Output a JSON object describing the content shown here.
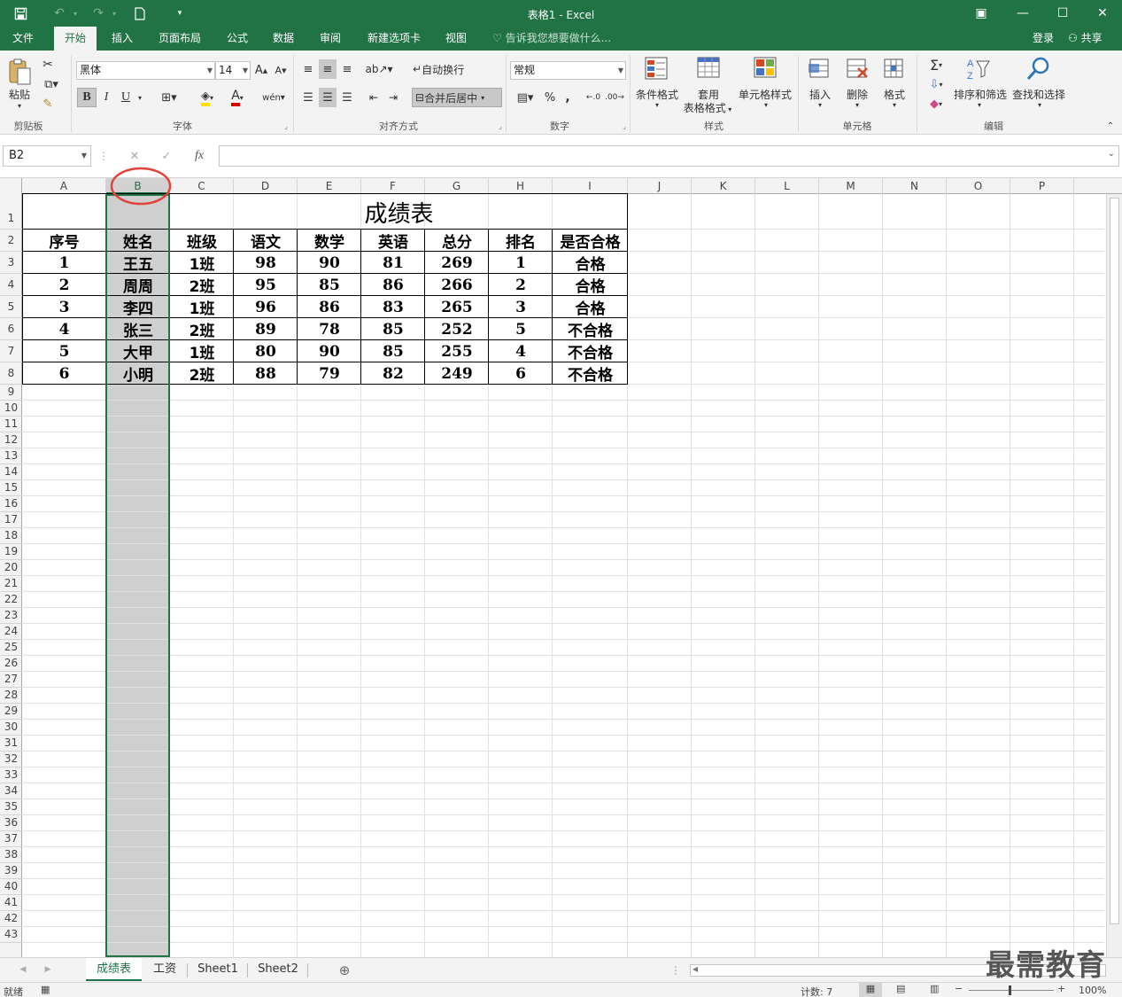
{
  "window": {
    "title": "表格1 - Excel"
  },
  "quick_access": {
    "save_icon": "save-icon",
    "undo_icon": "undo-icon",
    "redo_icon": "redo-icon",
    "new_icon": "new-document-icon",
    "customize_icon": "customize-icon"
  },
  "window_controls": {
    "ribbon_display": "▣",
    "minimize": "—",
    "maximize": "☐",
    "close": "✕"
  },
  "ribbon_tabs": [
    "文件",
    "开始",
    "插入",
    "页面布局",
    "公式",
    "数据",
    "审阅",
    "新建选项卡",
    "视图"
  ],
  "active_tab": "开始",
  "tell_me": "告诉我您想要做什么...",
  "account": {
    "login": "登录",
    "share": "共享"
  },
  "ribbon": {
    "clipboard": {
      "label": "剪贴板",
      "paste": "粘贴"
    },
    "font": {
      "label": "字体",
      "name": "黑体",
      "size": "14",
      "bold": "B",
      "italic": "I",
      "underline": "U",
      "grow": "A",
      "shrink": "A"
    },
    "alignment": {
      "label": "对齐方式",
      "wrap_text": "自动换行",
      "merge_center": "合并后居中"
    },
    "number": {
      "label": "数字",
      "format": "常规",
      "percent": "%",
      "comma": ","
    },
    "styles": {
      "label": "样式",
      "conditional": "条件格式",
      "table_1": "套用",
      "table_2": "表格格式",
      "cell_styles": "单元格样式"
    },
    "cells": {
      "label": "单元格",
      "insert": "插入",
      "delete": "删除",
      "format": "格式"
    },
    "editing": {
      "label": "编辑",
      "sort_filter": "排序和筛选",
      "find_select": "查找和选择"
    }
  },
  "formula_bar": {
    "name_box": "B2",
    "fx": "fx",
    "cancel": "✕",
    "enter": "✓",
    "value": ""
  },
  "columns": [
    "A",
    "B",
    "C",
    "D",
    "E",
    "F",
    "G",
    "H",
    "I",
    "J",
    "K",
    "L",
    "M",
    "N",
    "O",
    "P"
  ],
  "selected_column": "B",
  "sheet": {
    "title": "成绩表",
    "headers": [
      "序号",
      "姓名",
      "班级",
      "语文",
      "数学",
      "英语",
      "总分",
      "排名",
      "是否合格"
    ],
    "rows": [
      [
        "1",
        "王五",
        "1班",
        "98",
        "90",
        "81",
        "269",
        "1",
        "合格"
      ],
      [
        "2",
        "周周",
        "2班",
        "95",
        "85",
        "86",
        "266",
        "2",
        "合格"
      ],
      [
        "3",
        "李四",
        "1班",
        "96",
        "86",
        "83",
        "265",
        "3",
        "合格"
      ],
      [
        "4",
        "张三",
        "2班",
        "89",
        "78",
        "85",
        "252",
        "5",
        "不合格"
      ],
      [
        "5",
        "大甲",
        "1班",
        "80",
        "90",
        "85",
        "255",
        "4",
        "不合格"
      ],
      [
        "6",
        "小明",
        "2班",
        "88",
        "79",
        "82",
        "249",
        "6",
        "不合格"
      ]
    ]
  },
  "sheet_tabs": [
    "成绩表",
    "工资",
    "Sheet1",
    "Sheet2"
  ],
  "active_sheet": "成绩表",
  "status": {
    "ready": "就绪",
    "count": "计数: 7",
    "zoom": "100%"
  },
  "watermark": "最需教育",
  "accent_color": "#217346",
  "annotation_color": "#e0443a"
}
